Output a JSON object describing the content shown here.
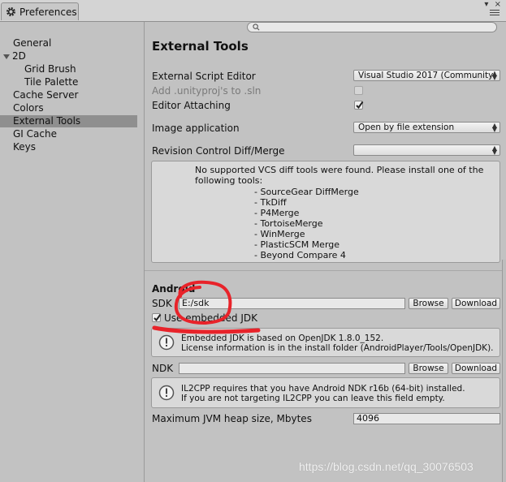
{
  "window": {
    "tab_title": "Preferences",
    "controls": "▾ ×"
  },
  "sidebar": {
    "items": [
      {
        "label": "General"
      },
      {
        "label": "2D"
      },
      {
        "label": "Grid Brush"
      },
      {
        "label": "Tile Palette"
      },
      {
        "label": "Cache Server"
      },
      {
        "label": "Colors"
      },
      {
        "label": "External Tools"
      },
      {
        "label": "GI Cache"
      },
      {
        "label": "Keys"
      }
    ],
    "selected": "External Tools"
  },
  "search": {
    "placeholder": ""
  },
  "external_tools": {
    "heading": "External Tools",
    "script_editor_label": "External Script Editor",
    "script_editor_value": "Visual Studio 2017 (Community)",
    "add_unityproj_label": "Add .unityproj's to .sln",
    "add_unityproj_checked": false,
    "editor_attaching_label": "Editor Attaching",
    "editor_attaching_checked": true,
    "image_app_label": "Image application",
    "image_app_value": "Open by file extension",
    "revision_label": "Revision Control Diff/Merge",
    "revision_value": "",
    "vcs_message": "No supported VCS diff tools were found. Please install one of the following tools:",
    "vcs_tools": [
      "- SourceGear DiffMerge",
      "- TkDiff",
      "- P4Merge",
      "- TortoiseMerge",
      "- WinMerge",
      "- PlasticSCM Merge",
      "- Beyond Compare 4"
    ]
  },
  "android": {
    "heading": "Android",
    "sdk_label": "SDK",
    "sdk_value": "E:/sdk",
    "browse_label": "Browse",
    "download_label": "Download",
    "embedded_jdk_label": "Use embedded JDK",
    "embedded_jdk_checked": true,
    "jdk_info_line1": "Embedded JDK is based on OpenJDK 1.8.0_152.",
    "jdk_info_line2": "License information is in the install folder (AndroidPlayer/Tools/OpenJDK).",
    "ndk_label": "NDK",
    "ndk_value": "",
    "ndk_info_line1": "IL2CPP requires that you have Android NDK r16b (64-bit) installed.",
    "ndk_info_line2": "If you are not targeting IL2CPP you can leave this field empty.",
    "heap_label": "Maximum JVM heap size, Mbytes",
    "heap_value": "4096"
  },
  "watermark": "https://blog.csdn.net/qq_30076503",
  "colors": {
    "annotation": "#e8232a",
    "selected_bg": "#8f8f8f",
    "panel_bg": "#c2c2c2"
  },
  "icons": [
    "gear-icon",
    "search-icon",
    "fold-arrow-icon",
    "info-icon",
    "checkmark-icon",
    "dropdown-arrow-icon"
  ]
}
